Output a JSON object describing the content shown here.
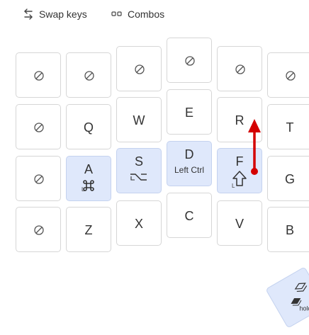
{
  "toolbar": {
    "swap_keys_label": "Swap keys",
    "combos_label": "Combos"
  },
  "keys": {
    "q": "Q",
    "w": "W",
    "e": "E",
    "r": "R",
    "t": "T",
    "a": "A",
    "s": "S",
    "d": "D",
    "f": "F",
    "g": "G",
    "z": "Z",
    "x": "X",
    "c": "C",
    "v": "V",
    "b": "B",
    "d_hold": "Left Ctrl",
    "mod_l": "L",
    "thumb_hold": "hold"
  },
  "colors": {
    "highlight": "#dfe8fb",
    "arrow": "#d40000"
  }
}
